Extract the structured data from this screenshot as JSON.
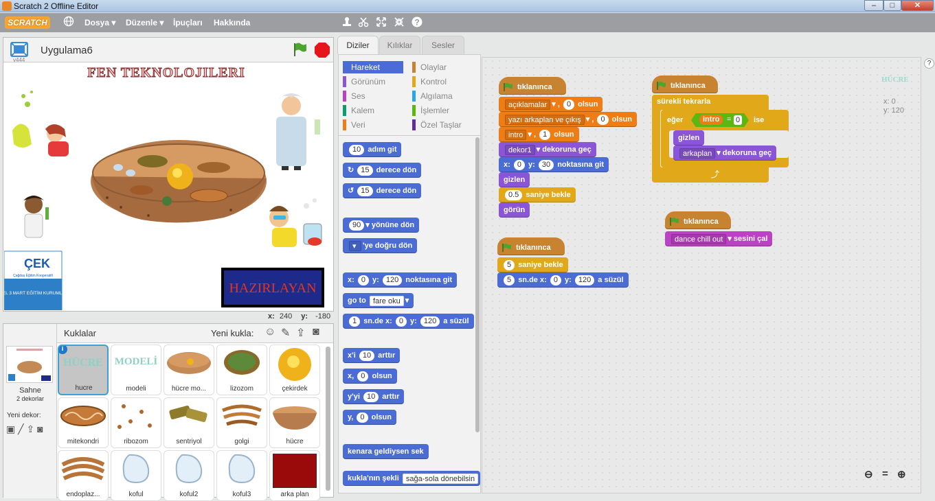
{
  "window": {
    "title": "Scratch 2 Offline Editor",
    "min": "–",
    "max": "□",
    "close": "✕"
  },
  "menubar": {
    "logo": "SCRATCH",
    "items": [
      "Dosya ▾",
      "Düzenle ▾",
      "İpuçları",
      "Hakkında"
    ]
  },
  "stage": {
    "project_name": "Uygulama6",
    "version": "v444",
    "title_art": "FEN TEKNOLOJILERI",
    "button": "HAZIRLAYAN",
    "logo_text": "ÇEK",
    "logo_sub": "Çağdaş Eğitim Kooperatifi",
    "school": "ÖZEL 3 MART EĞİTİM KURUMLARI",
    "x_label": "x:",
    "x_value": "240",
    "y_label": "y:",
    "y_value": "-180"
  },
  "sprites": {
    "header": "Kuklalar",
    "new_sprite": "Yeni kukla:",
    "stage_label": "Sahne",
    "stage_sub": "2 dekorlar",
    "new_backdrop": "Yeni dekor:",
    "items": [
      "hucre",
      "modeli",
      "hücre mo...",
      "lizozom",
      "çekirdek",
      "mitekondri",
      "ribozom",
      "sentriyol",
      "golgi",
      "hücre",
      "endoplaz...",
      "koful",
      "koful2",
      "koful3",
      "arka plan"
    ],
    "thumb_text": [
      "HÜCRE",
      "MODELİ"
    ]
  },
  "tabs": [
    "Diziler",
    "Kılıklar",
    "Sesler"
  ],
  "categories": [
    {
      "label": "Hareket",
      "color": "#4a6cd4"
    },
    {
      "label": "Görünüm",
      "color": "#8a55d7"
    },
    {
      "label": "Ses",
      "color": "#bb42c3"
    },
    {
      "label": "Kalem",
      "color": "#0e9a6c"
    },
    {
      "label": "Veri",
      "color": "#ee7d16"
    },
    {
      "label": "Olaylar",
      "color": "#c88330"
    },
    {
      "label": "Kontrol",
      "color": "#e1a91a"
    },
    {
      "label": "Algılama",
      "color": "#2ca5e2"
    },
    {
      "label": "İşlemler",
      "color": "#5cb712"
    },
    {
      "label": "Özel Taşlar",
      "color": "#632d99"
    }
  ],
  "palette": {
    "b1": {
      "n": "10",
      "t": "adım git"
    },
    "b2": {
      "n": "15",
      "t": "derece dön"
    },
    "b3": {
      "n": "15",
      "t": "derece dön"
    },
    "b4": {
      "n": "90",
      "t": "yönüne dön"
    },
    "b5": {
      "t": "'ye doğru dön"
    },
    "b6": {
      "a": "x:",
      "x": "0",
      "b": "y:",
      "y": "120",
      "t": "noktasına git"
    },
    "b7": {
      "a": "go to",
      "d": "fare oku"
    },
    "b8": {
      "n": "1",
      "a": "sn.de x:",
      "x": "0",
      "b": "y:",
      "y": "120",
      "t": "a süzül"
    },
    "b9": {
      "a": "x'i",
      "n": "10",
      "t": "arttır"
    },
    "b10": {
      "a": "x,",
      "n": "0",
      "t": "olsun"
    },
    "b11": {
      "a": "y'yi",
      "n": "10",
      "t": "arttır"
    },
    "b12": {
      "a": "y,",
      "n": "0",
      "t": "olsun"
    },
    "b13": {
      "t": "kenara geldiysen sek"
    },
    "b14": {
      "t": "kukla'nın şekli",
      "d": "sağa-sola dönebilsin"
    }
  },
  "scripts": {
    "hat": "tıklanınca",
    "s1": {
      "l1": {
        "d": "açıklamalar",
        "a": ",",
        "n": "0",
        "t": "olsun"
      },
      "l2": {
        "d": "yazı arkaplan ve çıkış",
        "a": ",",
        "n": "0",
        "t": "olsun"
      },
      "l3": {
        "d": "intro",
        "a": ",",
        "n": "1",
        "t": "olsun"
      },
      "l4": {
        "d": "dekor1",
        "t": "dekoruna geç"
      },
      "l5": {
        "a": "x:",
        "x": "0",
        "b": "y:",
        "y": "30",
        "t": "noktasına git"
      },
      "l6": {
        "t": "gizlen"
      },
      "l7": {
        "n": "0.5",
        "t": "saniye bekle"
      },
      "l8": {
        "t": "görün"
      }
    },
    "s2": {
      "l1": {
        "n": "5",
        "t": "saniye bekle"
      },
      "l2": {
        "n": "5",
        "a": "sn.de x:",
        "x": "0",
        "b": "y:",
        "y": "120",
        "t": "a süzül"
      }
    },
    "s3": {
      "forever": "sürekli tekrarla",
      "if": "eğer",
      "var": "intro",
      "eq": "=",
      "val": "0",
      "then": "ise",
      "hide": "gizlen",
      "d": "arkaplan",
      "t": "dekoruna geç"
    },
    "s4": {
      "d": "dance chill out",
      "t": "sesini çal"
    },
    "sprite_name": "HÜCRE",
    "coords": {
      "x": "x: 0",
      "y": "y: 120"
    }
  }
}
